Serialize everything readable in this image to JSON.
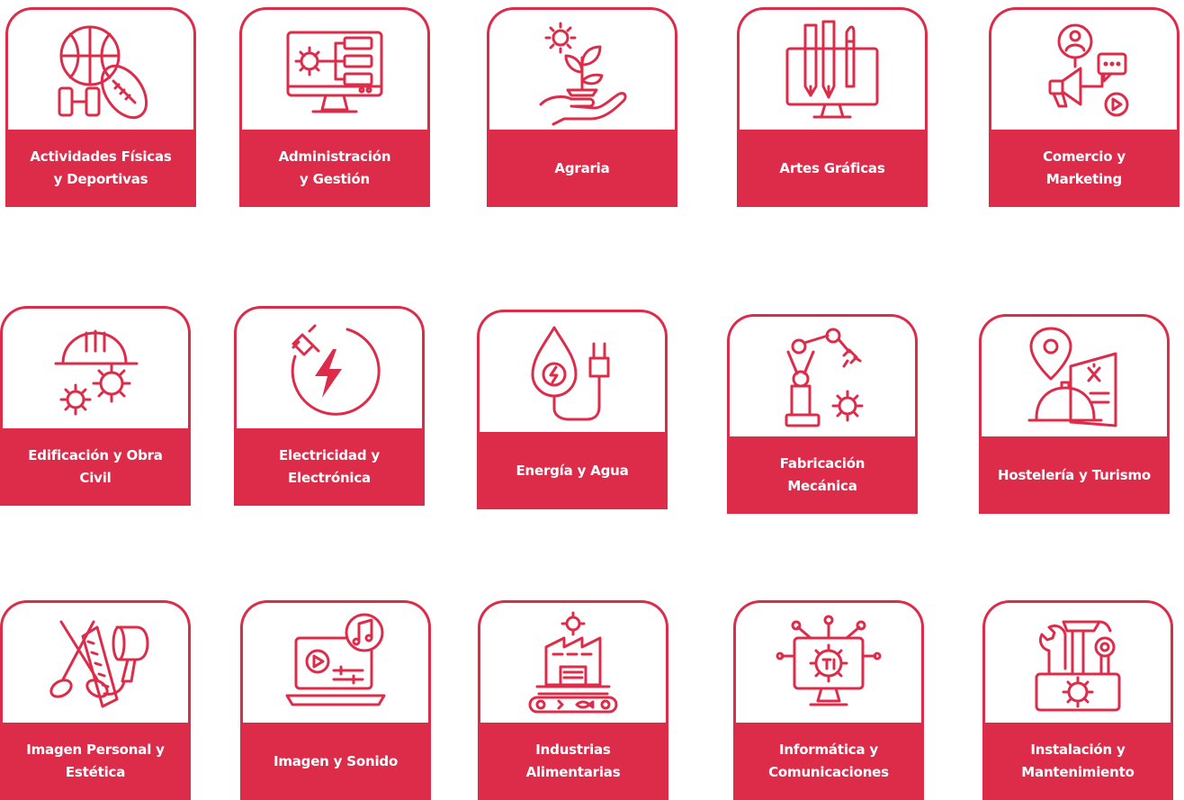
{
  "brand_color": "#dc2c4a",
  "families": [
    {
      "label": "Actividades Físicas\ny Deportivas",
      "icon": "sports-balls-icon"
    },
    {
      "label": "Administración\ny Gestión",
      "icon": "monitor-gear-flowchart-icon"
    },
    {
      "label": "Agraria",
      "icon": "hand-plant-sun-icon"
    },
    {
      "label": "Artes Gráficas",
      "icon": "monitor-pencils-icon"
    },
    {
      "label": "Comercio y\nMarketing",
      "icon": "megaphone-user-chat-icon"
    },
    {
      "label": "Edificación y Obra\nCivil",
      "icon": "helmet-gears-icon"
    },
    {
      "label": "Electricidad y\nElectrónica",
      "icon": "plug-lightning-icon"
    },
    {
      "label": "Energía y Agua",
      "icon": "water-drop-plug-icon"
    },
    {
      "label": "Fabricación\nMecánica",
      "icon": "robotic-arm-gear-icon"
    },
    {
      "label": "Hostelería y Turismo",
      "icon": "location-cloche-menu-icon"
    },
    {
      "label": "Imagen Personal y\nEstética",
      "icon": "scissors-comb-hairdryer-icon"
    },
    {
      "label": "Imagen y Sonido",
      "icon": "laptop-video-music-icon"
    },
    {
      "label": "Industrias\nAlimentarias",
      "icon": "factory-conveyor-icon"
    },
    {
      "label": "Informática y\nComunicaciones",
      "icon": "monitor-network-gear-icon"
    },
    {
      "label": "Instalación y\nMantenimiento",
      "icon": "toolbox-tools-icon"
    }
  ]
}
